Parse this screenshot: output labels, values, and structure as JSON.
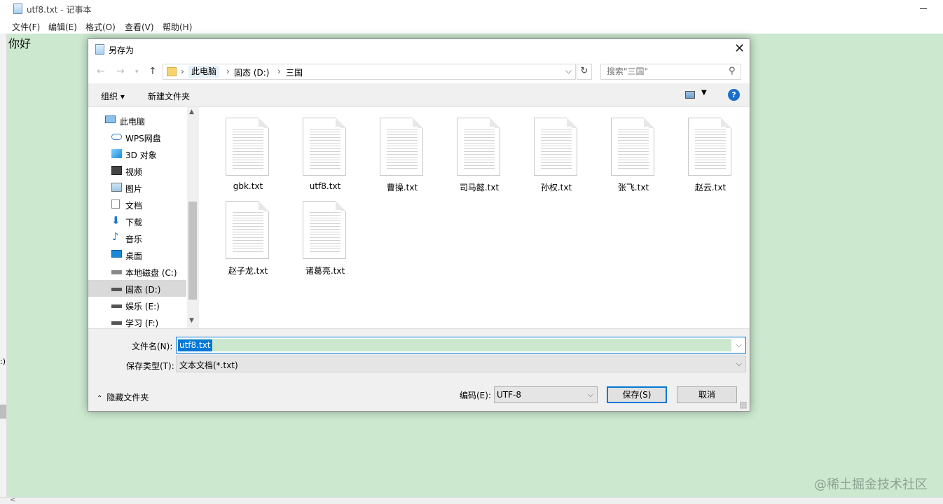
{
  "notepad": {
    "title": "utf8.txt - 记事本",
    "menu": [
      "文件(F)",
      "编辑(E)",
      "格式(O)",
      "查看(V)",
      "帮助(H)"
    ],
    "content": "你好"
  },
  "dialog": {
    "title": "另存为",
    "breadcrumb": [
      "此电脑",
      "固态 (D:)",
      "三国"
    ],
    "search_placeholder": "搜索\"三国\"",
    "toolbar": {
      "organize": "组织 ▾",
      "new_folder": "新建文件夹"
    },
    "sidebar": [
      {
        "label": "此电脑",
        "icon": "computer-icon"
      },
      {
        "label": "WPS网盘",
        "icon": "cloud-icon"
      },
      {
        "label": "3D 对象",
        "icon": "cube-icon"
      },
      {
        "label": "视频",
        "icon": "video-icon"
      },
      {
        "label": "图片",
        "icon": "picture-icon"
      },
      {
        "label": "文档",
        "icon": "document-icon"
      },
      {
        "label": "下载",
        "icon": "download-icon"
      },
      {
        "label": "音乐",
        "icon": "music-icon"
      },
      {
        "label": "桌面",
        "icon": "desktop-icon"
      },
      {
        "label": "本地磁盘 (C:)",
        "icon": "drive-icon"
      },
      {
        "label": "固态 (D:)",
        "icon": "drive-icon"
      },
      {
        "label": "娱乐 (E:)",
        "icon": "drive-icon"
      },
      {
        "label": "学习 (F:)",
        "icon": "drive-icon"
      }
    ],
    "sidebar_selected": "固态 (D:)",
    "files": [
      "gbk.txt",
      "utf8.txt",
      "曹操.txt",
      "司马懿.txt",
      "孙权.txt",
      "张飞.txt",
      "赵云.txt",
      "赵子龙.txt",
      "诸葛亮.txt"
    ],
    "filename_label": "文件名(N):",
    "filename_value": "utf8.txt",
    "filetype_label": "保存类型(T):",
    "filetype_value": "文本文档(*.txt)",
    "hide_folders": "隐藏文件夹",
    "encoding_label": "编码(E):",
    "encoding_value": "UTF-8",
    "save_button": "保存(S)",
    "cancel_button": "取消"
  },
  "watermark": "@稀土掘金技术社区"
}
